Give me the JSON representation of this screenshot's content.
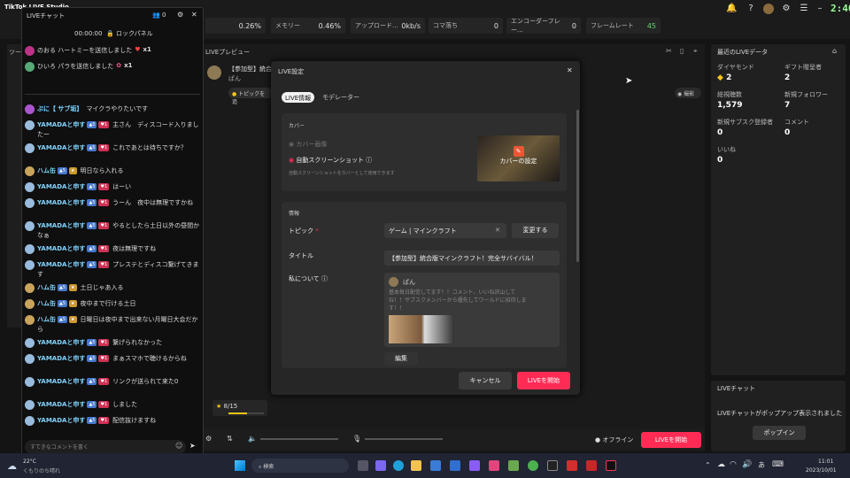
{
  "topbar": {
    "app_title": "TikTok LIVE Studio",
    "metrics": [
      {
        "label": "",
        "value": "0.26%"
      },
      {
        "label": "メモリー",
        "value": "0.46%"
      },
      {
        "label": "アップロード...",
        "value": "0kb/s"
      },
      {
        "label": "コマ落ち",
        "value": "0"
      },
      {
        "label": "エンコーダーフレー...",
        "value": "0"
      },
      {
        "label": "フレームレート",
        "value": "45"
      }
    ],
    "clock": "2:40"
  },
  "chat": {
    "title": "LIVEチャット",
    "viewers": "0",
    "timer": "00:00:00",
    "lock_label": "ロックパネル",
    "gifts": [
      {
        "text": "のおる ハートミーを送信しました",
        "count": "x1"
      },
      {
        "text": "ひいろ パラを送信しました",
        "count": "x1"
      }
    ],
    "messages": [
      {
        "user": "ぷに【 サブ垢】",
        "text": "マイクラやりたいです",
        "color": "#7fd4ff"
      },
      {
        "user": "YAMADAと申す",
        "text": "主さん　ディスコード入りましたー",
        "color": "#7fd4ff"
      },
      {
        "user": "YAMADAと申す",
        "text": "これであとは待ちですか？",
        "color": "#7fd4ff"
      },
      {
        "user": "ハム缶",
        "text": "明日なら入れる",
        "color": "#7fd4ff"
      },
      {
        "user": "YAMADAと申す",
        "text": "はーい",
        "color": "#7fd4ff"
      },
      {
        "user": "YAMADAと申す",
        "text": "うーん　夜中は無理ですかね",
        "color": "#7fd4ff"
      },
      {
        "user": "YAMADAと申す",
        "text": "やるとしたら土日以外の昼間かなぁ",
        "color": "#7fd4ff"
      },
      {
        "user": "YAMADAと申す",
        "text": "夜は無理ですね",
        "color": "#7fd4ff"
      },
      {
        "user": "YAMADAと申す",
        "text": "プレステとディスコ繋げてきます",
        "color": "#7fd4ff"
      },
      {
        "user": "ハム缶",
        "text": "土日じゃあ入る",
        "color": "#7fd4ff"
      },
      {
        "user": "ハム缶",
        "text": "夜中まで行ける土日",
        "color": "#7fd4ff"
      },
      {
        "user": "ハム缶",
        "text": "日曜日は夜中まで出来ない月曜日大会だから",
        "color": "#7fd4ff"
      },
      {
        "user": "YAMADAと申す",
        "text": "繋げられなかった",
        "color": "#7fd4ff"
      },
      {
        "user": "YAMADAと申す",
        "text": "まぁスマホで聴けるからね",
        "color": "#7fd4ff"
      },
      {
        "user": "YAMADAと申す",
        "text": "リンクが送られて来た0",
        "color": "#7fd4ff"
      },
      {
        "user": "YAMADAと申す",
        "text": "しました",
        "color": "#7fd4ff"
      },
      {
        "user": "YAMADAと申す",
        "text": "配信抜けますね",
        "color": "#7fd4ff"
      }
    ],
    "input_placeholder": "すてきなコメントを書く"
  },
  "center": {
    "preview_label": "LIVEプレビュー",
    "stream_title_snippet": "【参加型】統合",
    "streamer": "ぱん",
    "topic_btn": "トピックを追",
    "stars": "8/15",
    "offline_label": "オフライン",
    "go_live": "LIVEを開始",
    "left_panel_label": "ツー"
  },
  "modal": {
    "title": "LIVE設定",
    "tabs": [
      "LIVE情報",
      "モデレーター"
    ],
    "cover_section": "カバー",
    "cover_option1": "カバー画像",
    "cover_option2": "自動スクリーンショット",
    "cover_desc": "自動スクリーンショットをカバーとして使用できます",
    "cover_btn": "カバーの設定",
    "info_section": "情報",
    "topic_label": "トピック",
    "topic_value": "ゲーム | マインクラフト",
    "topic_change": "変更する",
    "title_label": "タイトル",
    "title_value": "【参加型】統合版マインクラフト！完全サバイバル！",
    "about_label": "私について",
    "about_name": "ぱん",
    "about_text": "基本毎日配信してます！！コメント、いいね沢山してね！！サブスクメンバーから優先してワールドに招待します！！",
    "edit_btn": "編集",
    "cancel_btn": "キャンセル",
    "start_btn": "LIVEを開始"
  },
  "right": {
    "title": "最近のLIVEデータ",
    "stats": [
      {
        "label": "ダイヤモンド",
        "value": "2"
      },
      {
        "label": "ギフト贈呈者",
        "value": "2"
      },
      {
        "label": "総視聴数",
        "value": "1,579"
      },
      {
        "label": "新規フォロワー",
        "value": "7"
      },
      {
        "label": "新規サブスク登録者",
        "value": "0"
      },
      {
        "label": "コメント",
        "value": "0"
      },
      {
        "label": "いいね",
        "value": "0"
      }
    ],
    "chat_title": "LIVEチャット",
    "chat_msg": "LIVEチャットがポップアップ表示されました",
    "popin_btn": "ポップイン",
    "capture": "撮影"
  },
  "taskbar": {
    "weather_temp": "22°C",
    "weather_desc": "くもりのち晴れ",
    "search": "検索",
    "time": "11:01",
    "date": "2023/10/01",
    "ime": "あ"
  }
}
